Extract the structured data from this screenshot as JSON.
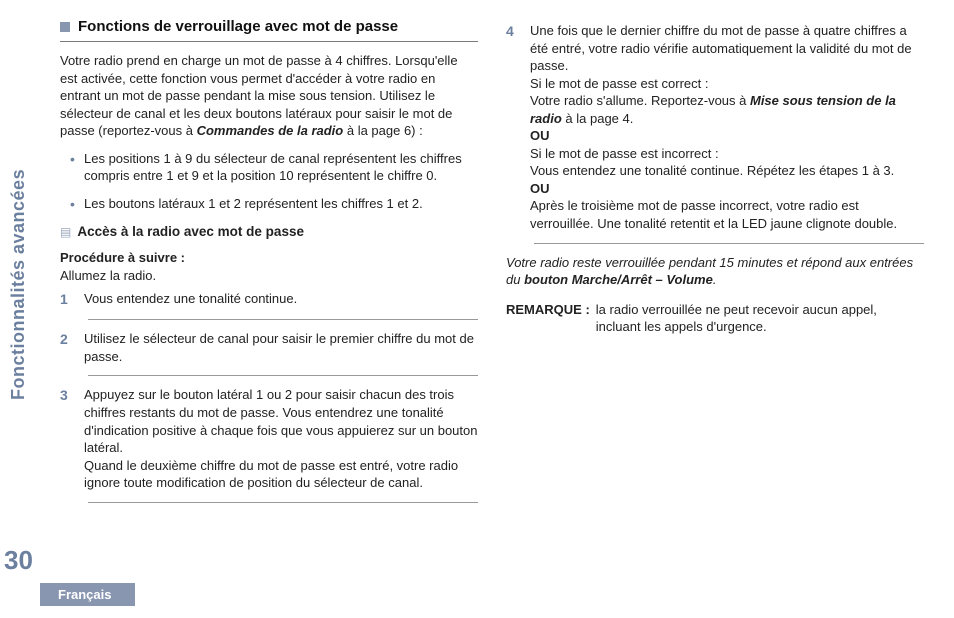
{
  "rail": {
    "sideTitle": "Fonctionnalités avancées",
    "pageNumber": "30",
    "language": "Français"
  },
  "left": {
    "h1": "Fonctions de verrouillage avec mot de passe",
    "intro_a": "Votre radio prend en charge un mot de passe à 4 chiffres. Lorsqu'elle est activée, cette fonction vous permet d'accéder à votre radio en entrant un mot de passe pendant la mise sous tension. Utilisez le sélecteur de canal et les deux boutons latéraux pour saisir le mot de passe (reportez-vous à ",
    "intro_ref": "Commandes de la radio",
    "intro_b": " à la page 6) :",
    "bullets": [
      "Les positions 1 à 9 du sélecteur de canal représentent les chiffres compris entre 1 et 9 et la position 10 représentent le chiffre 0.",
      "Les boutons latéraux 1 et 2 représentent les chiffres 1 et 2."
    ],
    "h2": "Accès à la radio avec mot de passe",
    "procLabel": "Procédure à suivre :",
    "procIntro": "Allumez la radio.",
    "steps": {
      "1": "Vous entendez une tonalité continue.",
      "2": "Utilisez le sélecteur de canal pour saisir le premier chiffre du mot de passe.",
      "3": "Appuyez sur le bouton latéral 1 ou 2 pour saisir chacun des trois chiffres restants du mot de passe. Vous entendrez une tonalité d'indication positive à chaque fois que vous appuierez sur un bouton latéral.\nQuand le deuxième chiffre du mot de passe est entré, votre radio ignore toute modification de position du sélecteur de canal."
    }
  },
  "right": {
    "step4": {
      "l1": "Une fois que le dernier chiffre du mot de passe à quatre chiffres a été entré, votre radio vérifie automatiquement la validité du mot de passe.",
      "l2": "Si le mot de passe est correct :",
      "l3a": "Votre radio s'allume. Reportez-vous à ",
      "l3ref": "Mise sous tension de la radio",
      "l3b": " à la page 4.",
      "or": "OU",
      "l4": "Si le mot de passe est incorrect :",
      "l5": "Vous entendez une tonalité continue. Répétez les étapes 1 à 3.",
      "l6": "Après le troisième mot de passe incorrect, votre radio est verrouillée. Une tonalité retentit et la LED jaune clignote double."
    },
    "locknote_a": "Votre radio reste verrouillée pendant 15 minutes et répond aux entrées du ",
    "locknote_b": "bouton Marche/Arrêt – Volume",
    "locknote_c": ".",
    "remarkLabel": "REMARQUE :",
    "remarkText": "la radio verrouillée ne peut recevoir aucun appel, incluant les appels d'urgence."
  }
}
